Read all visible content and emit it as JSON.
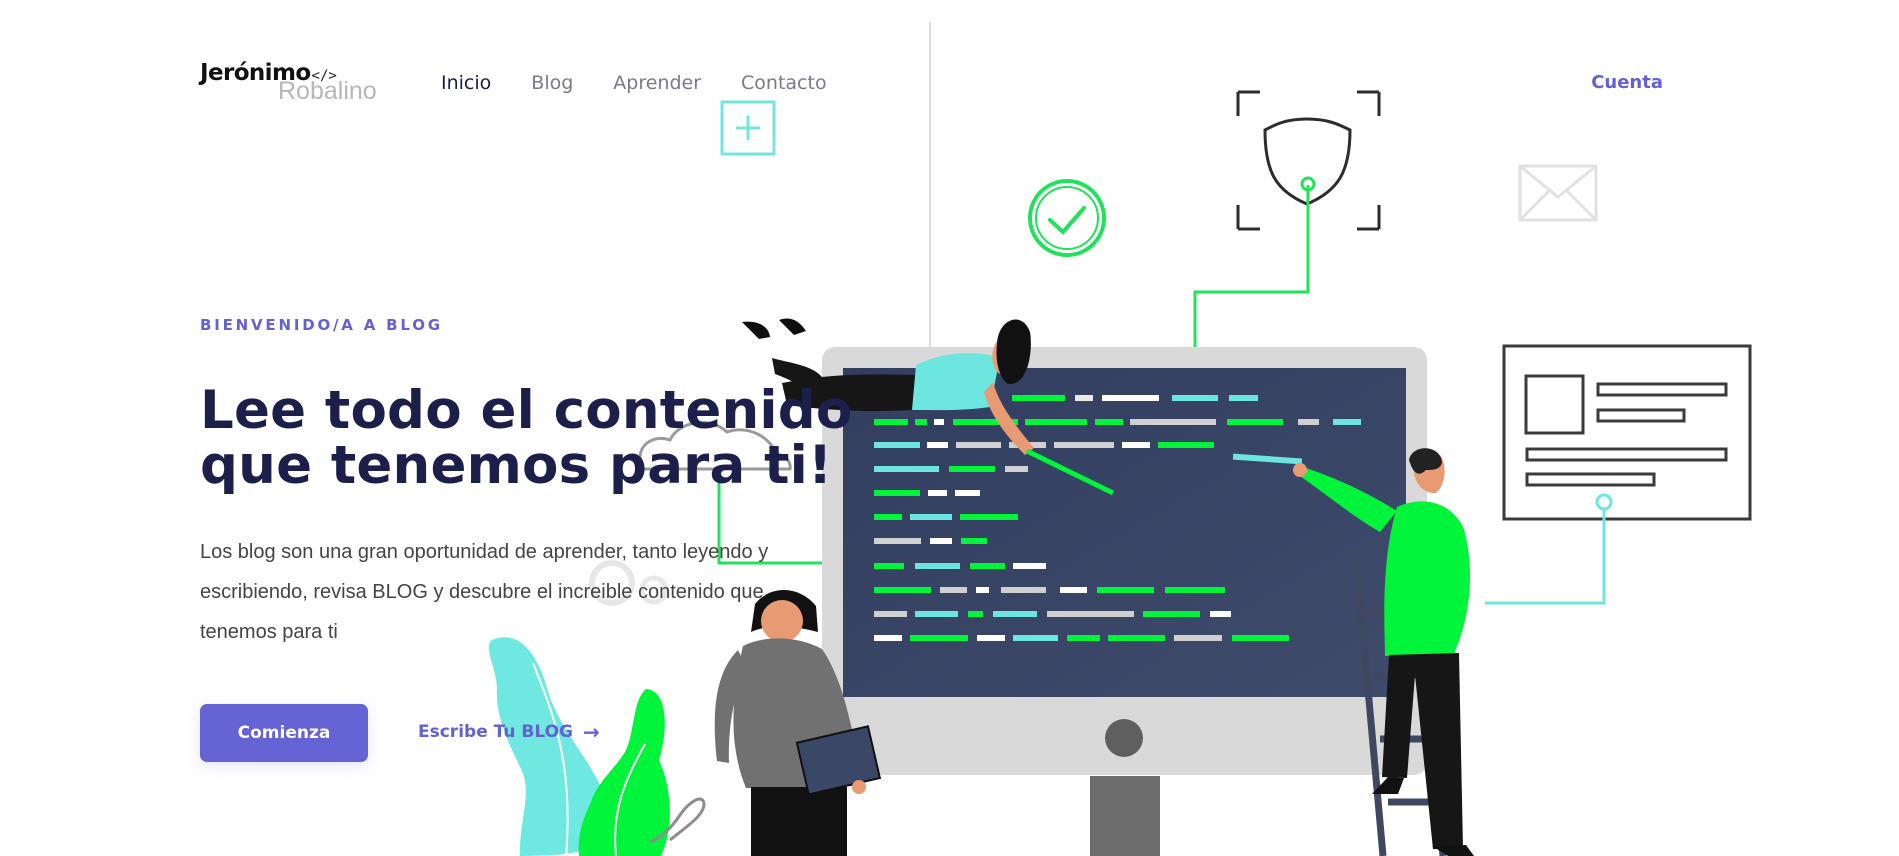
{
  "header": {
    "logo_name": "Jerónimo",
    "logo_code_icon": "</>",
    "logo_sub": "Robalino",
    "nav": [
      {
        "label": "Inicio",
        "active": true
      },
      {
        "label": "Blog",
        "active": false
      },
      {
        "label": "Aprender",
        "active": false
      },
      {
        "label": "Contacto",
        "active": false
      }
    ],
    "account_label": "Cuenta"
  },
  "hero": {
    "eyebrow": "BIENVENIDO/A A BLOG",
    "title_line_1": "Lee todo el contenido",
    "title_line_2": "que tenemos para ti!",
    "text": "Los blog son una gran oportunidad de aprender, tanto leyendo y escribiendo, revisa BLOG y descubre el increible contenido que tenemos para ti",
    "primary_button": "Comienza",
    "secondary_link": "Escribe Tu BLOG",
    "secondary_icon": "arrow-right-icon"
  },
  "colors": {
    "brand": "#6461d1",
    "headline": "#1c1f4a",
    "accent_green": "#00f53a",
    "accent_cyan": "#6de6df",
    "monitor_screen": "#3a4767"
  }
}
